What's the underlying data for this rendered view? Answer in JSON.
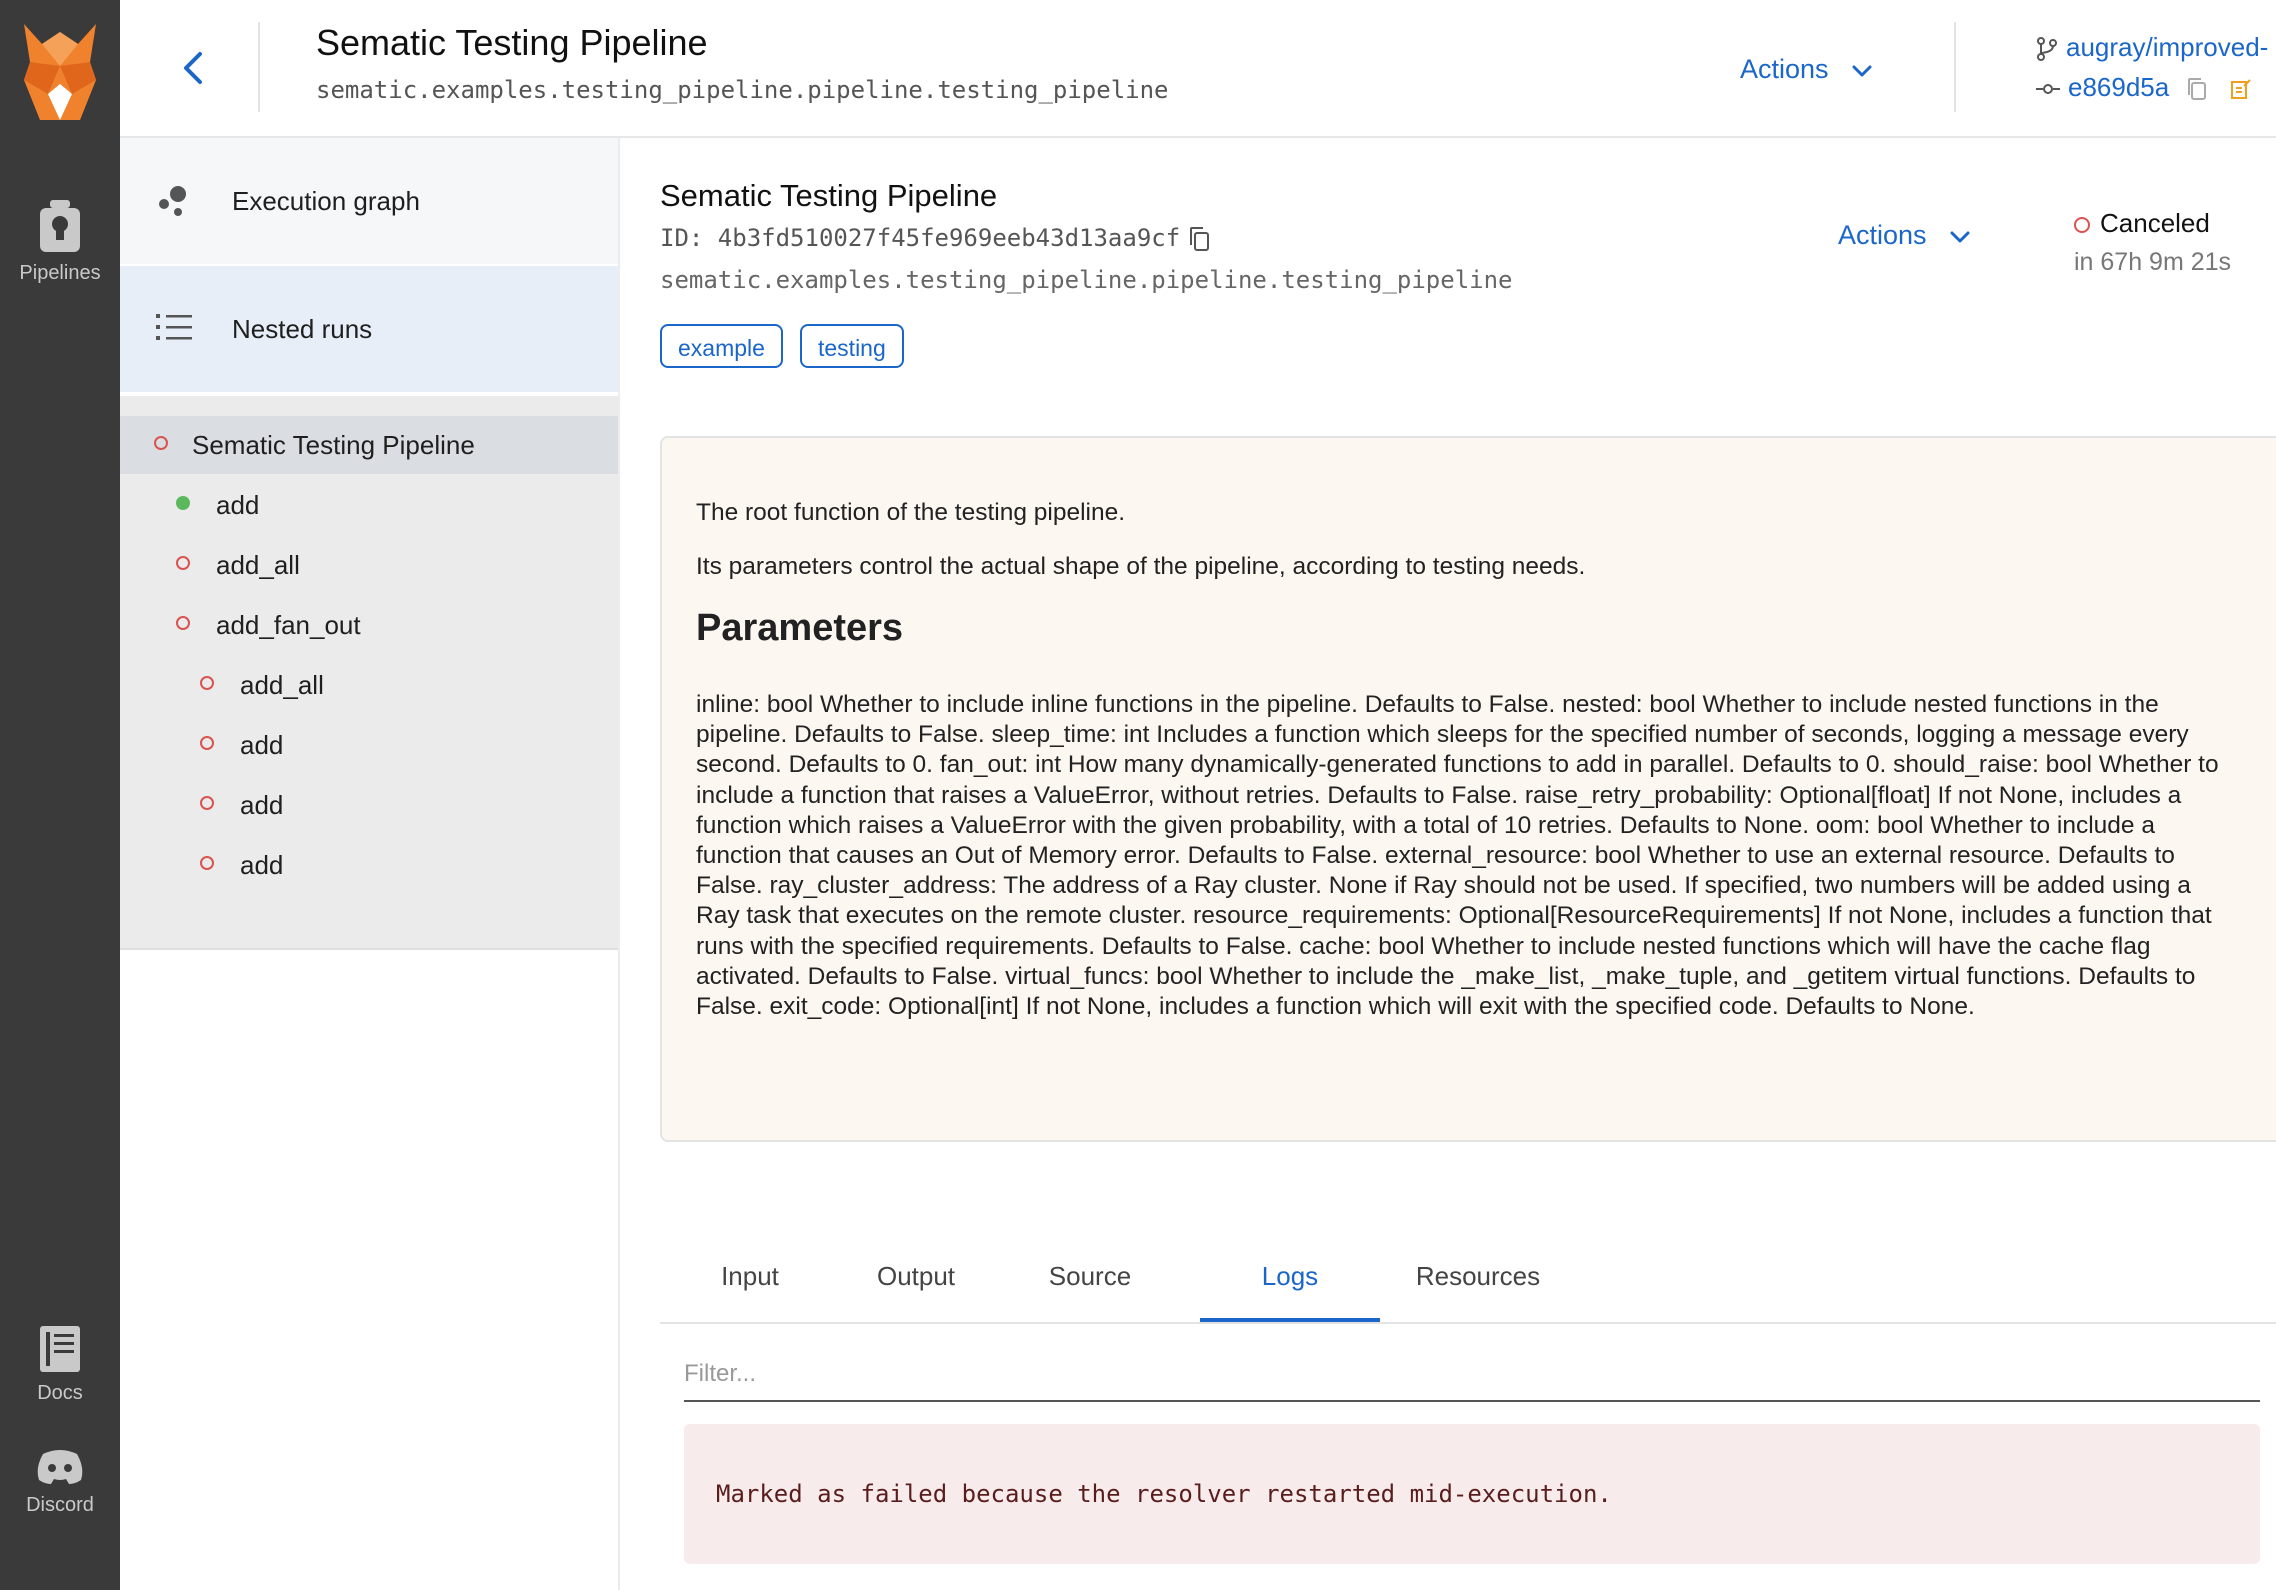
{
  "rail": {
    "pipelines_label": "Pipelines",
    "docs_label": "Docs",
    "discord_label": "Discord"
  },
  "header": {
    "title": "Sematic Testing Pipeline",
    "subtitle": "sematic.examples.testing_pipeline.pipeline.testing_pipeline",
    "actions_label": "Actions",
    "git_branch": "augray/improved-",
    "git_commit": "e869d5a"
  },
  "sidebar": {
    "nav": [
      {
        "label": "Execution graph"
      },
      {
        "label": "Nested runs"
      }
    ],
    "tree": [
      {
        "label": "Sematic Testing Pipeline",
        "status": "canceled"
      },
      {
        "label": "add",
        "status": "succeeded"
      },
      {
        "label": "add_all",
        "status": "canceled"
      },
      {
        "label": "add_fan_out",
        "status": "canceled"
      },
      {
        "label": "add_all",
        "status": "canceled"
      },
      {
        "label": "add",
        "status": "canceled"
      },
      {
        "label": "add",
        "status": "canceled"
      },
      {
        "label": "add",
        "status": "canceled"
      }
    ]
  },
  "run": {
    "title": "Sematic Testing Pipeline",
    "id_label": "ID: 4b3fd510027f45fe969eeb43d13aa9cf",
    "path": "sematic.examples.testing_pipeline.pipeline.testing_pipeline",
    "tags": [
      "example",
      "testing"
    ],
    "actions_label": "Actions",
    "status": "Canceled",
    "status_time": "in 67h 9m 21s",
    "status_color": "#d9534f"
  },
  "docstring": {
    "intro1": "The root function of the testing pipeline.",
    "intro2": "Its parameters control the actual shape of the pipeline, according to testing needs.",
    "params_heading": "Parameters",
    "params_body": "inline: bool Whether to include inline functions in the pipeline. Defaults to False. nested: bool Whether to include nested functions in the pipeline. Defaults to False. sleep_time: int Includes a function which sleeps for the specified number of seconds, logging a message every second. Defaults to 0. fan_out: int How many dynamically-generated functions to add in parallel. Defaults to 0. should_raise: bool Whether to include a function that raises a ValueError, without retries. Defaults to False. raise_retry_probability: Optional[float] If not None, includes a function which raises a ValueError with the given probability, with a total of 10 retries. Defaults to None. oom: bool Whether to include a function that causes an Out of Memory error. Defaults to False. external_resource: bool Whether to use an external resource. Defaults to False. ray_cluster_address: The address of a Ray cluster. None if Ray should not be used. If specified, two numbers will be added using a Ray task that executes on the remote cluster. resource_requirements: Optional[ResourceRequirements] If not None, includes a function that runs with the specified requirements. Defaults to False. cache: bool Whether to include nested functions which will have the cache flag activated. Defaults to False. virtual_funcs: bool Whether to include the _make_list, _make_tuple, and _getitem virtual functions. Defaults to False. exit_code: Optional[int] If not None, includes a function which will exit with the specified code. Defaults to None."
  },
  "tabs": [
    {
      "label": "Input"
    },
    {
      "label": "Output"
    },
    {
      "label": "Source"
    },
    {
      "label": "Logs",
      "active": true
    },
    {
      "label": "Resources"
    }
  ],
  "logs": {
    "filter_placeholder": "Filter...",
    "filter_value": "",
    "line": "Marked as failed because the resolver restarted mid-execution."
  },
  "colors": {
    "accent": "#1b66c9",
    "rail_bg": "#3a3a3a",
    "logo_orange": "#f0822d",
    "error": "#d9534f",
    "success": "#5cb85c"
  }
}
